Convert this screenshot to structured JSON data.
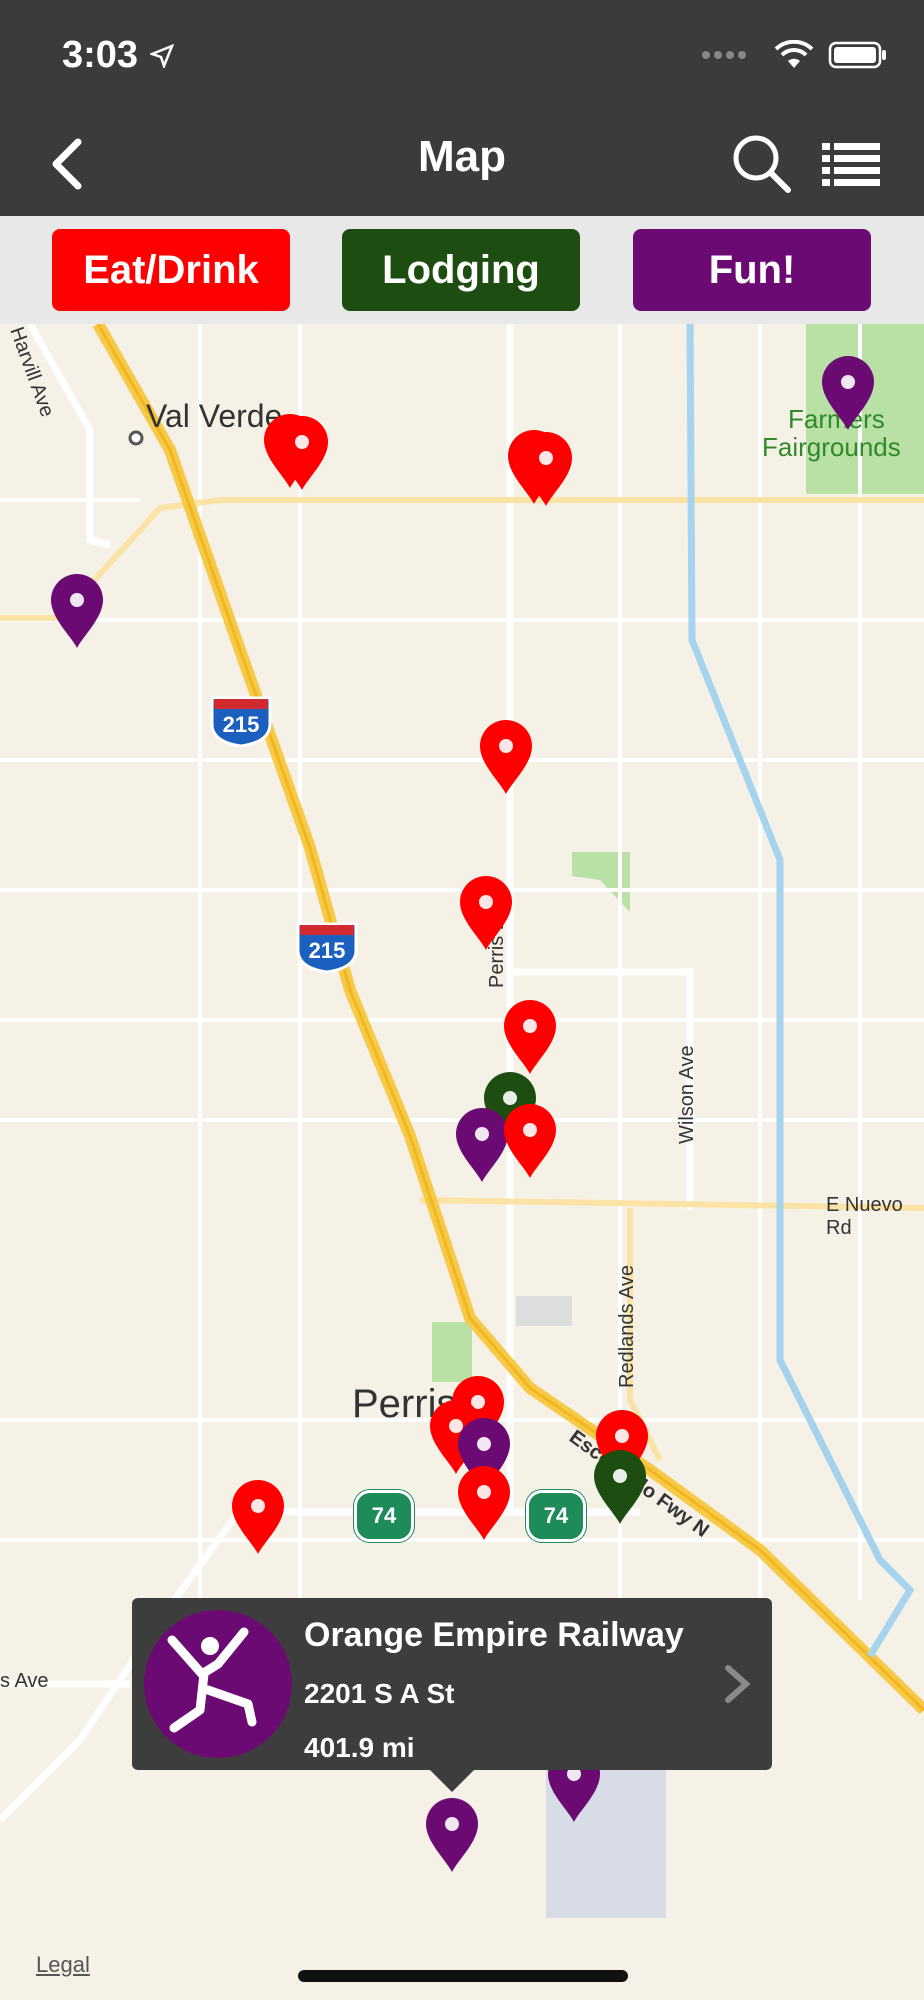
{
  "status": {
    "time": "3:03"
  },
  "nav": {
    "title": "Map"
  },
  "filters": [
    {
      "label": "Eat/Drink",
      "color": "#ff0000"
    },
    {
      "label": "Lodging",
      "color": "#1e4d11"
    },
    {
      "label": "Fun!",
      "color": "#6c0a73"
    }
  ],
  "map": {
    "labels": {
      "val_verde": "Val Verde",
      "farmers": "Farmers",
      "fairgrounds": "Fairgrounds",
      "perris_blvd": "Perris Blvd",
      "wilson": "Wilson Ave",
      "nuevo": "E Nuevo Rd",
      "redlands": "Redlands Ave",
      "perris": "Perris",
      "escondido": "Escondido Fwy N",
      "harvill": "Harvill Ave",
      "ave_left": "s Ave",
      "i215_a": "215",
      "i215_b": "215",
      "sr74_a": "74",
      "sr74_b": "74"
    },
    "legal": "Legal"
  },
  "callout": {
    "name": "Orange Empire Railway",
    "address": "2201 S A St",
    "distance": "401.9 mi"
  },
  "colors": {
    "eat": "#ff0000",
    "lodging": "#1e4d11",
    "fun": "#6c0a73"
  }
}
